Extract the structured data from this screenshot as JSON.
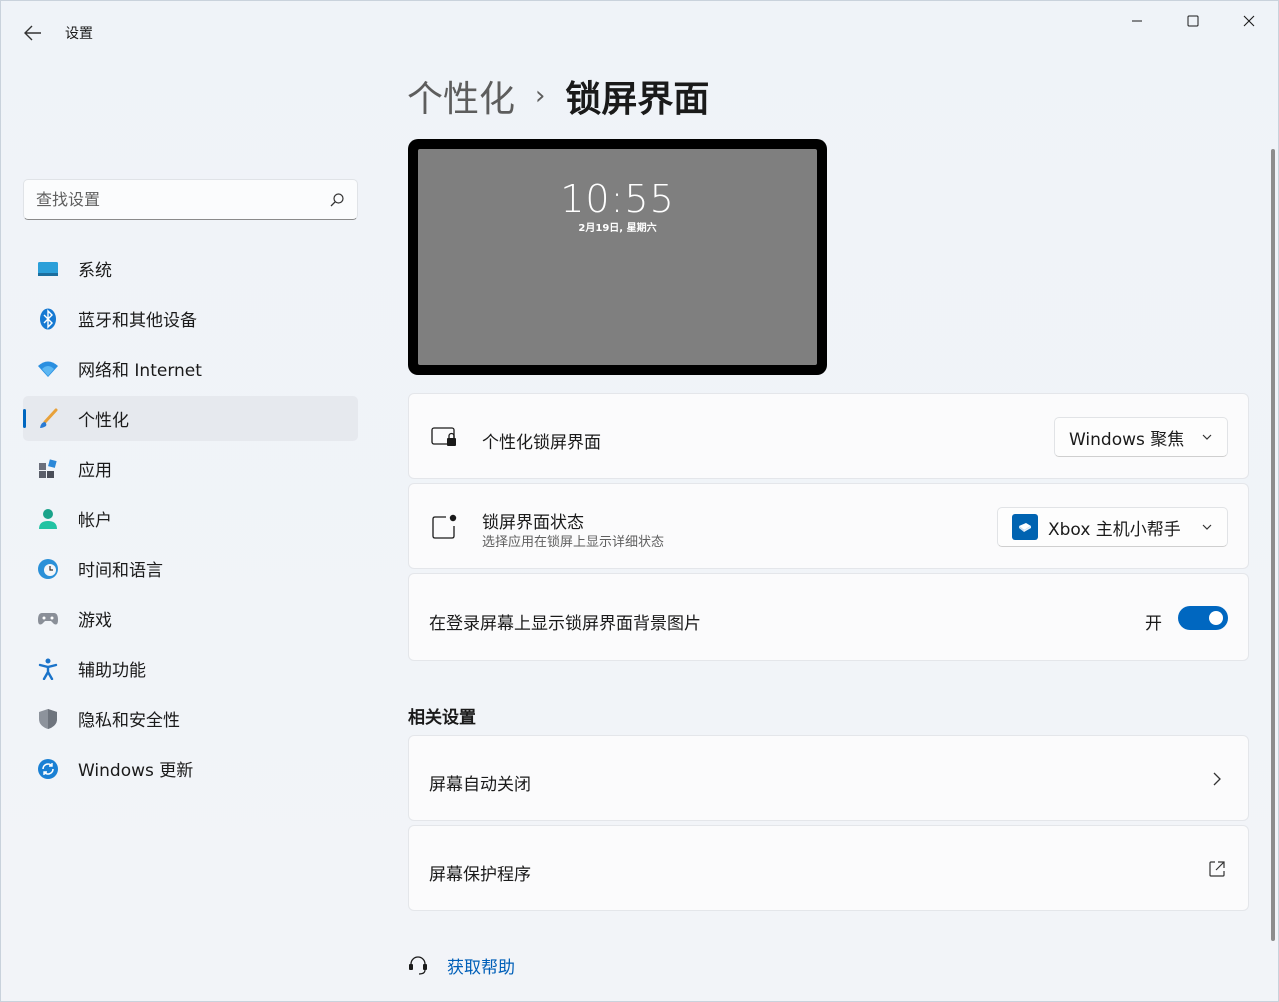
{
  "window": {
    "app_title": "设置",
    "controls": {
      "minimize": "minimize-icon",
      "maximize": "maximize-icon",
      "close": "close-icon"
    }
  },
  "sidebar": {
    "search": {
      "placeholder": "查找设置"
    },
    "items": [
      {
        "label": "系统",
        "icon": "system-icon"
      },
      {
        "label": "蓝牙和其他设备",
        "icon": "bluetooth-icon"
      },
      {
        "label": "网络和 Internet",
        "icon": "wifi-icon"
      },
      {
        "label": "个性化",
        "icon": "brush-icon",
        "active": true
      },
      {
        "label": "应用",
        "icon": "apps-icon"
      },
      {
        "label": "帐户",
        "icon": "account-icon"
      },
      {
        "label": "时间和语言",
        "icon": "clock-globe-icon"
      },
      {
        "label": "游戏",
        "icon": "gamepad-icon"
      },
      {
        "label": "辅助功能",
        "icon": "accessibility-icon"
      },
      {
        "label": "隐私和安全性",
        "icon": "shield-icon"
      },
      {
        "label": "Windows 更新",
        "icon": "update-icon"
      }
    ]
  },
  "breadcrumb": {
    "parent": "个性化",
    "separator": "›",
    "current": "锁屏界面"
  },
  "preview": {
    "time": "10:55",
    "date": "2月19日, 星期六"
  },
  "settings": {
    "personalize_lock": {
      "title": "个性化锁屏界面",
      "value": "Windows 聚焦"
    },
    "lock_status": {
      "title": "锁屏界面状态",
      "subtitle": "选择应用在锁屏上显示详细状态",
      "value": "Xbox 主机小帮手"
    },
    "signin_background": {
      "title": "在登录屏幕上显示锁屏界面背景图片",
      "state_label": "开",
      "on": true
    }
  },
  "related": {
    "title": "相关设置",
    "items": [
      {
        "label": "屏幕自动关闭",
        "end_icon": "chevron-right-icon"
      },
      {
        "label": "屏幕保护程序",
        "end_icon": "external-link-icon"
      }
    ]
  },
  "help": {
    "label": "获取帮助"
  },
  "colors": {
    "accent": "#0067c0",
    "link": "#005fb8"
  }
}
